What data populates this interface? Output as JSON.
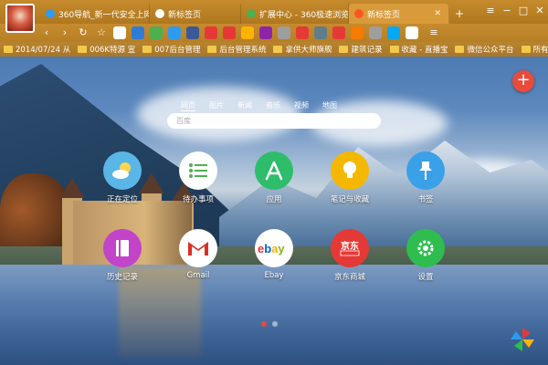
{
  "browser": {
    "tabs": [
      {
        "label": "360导航_新一代安全上网",
        "fav": "#2e9bf0",
        "active": false
      },
      {
        "label": "新标签页",
        "fav": "#ffffff",
        "active": false
      },
      {
        "label": "扩展中心 - 360极速浏览",
        "fav": "#4caf50",
        "active": false
      },
      {
        "label": "新标签页",
        "fav": "#ff5722",
        "active": true
      }
    ],
    "new_tab": "+",
    "win_controls": [
      "≡",
      "−",
      "□",
      "✕"
    ]
  },
  "navbar": {
    "back": "‹",
    "forward": "›",
    "refresh": "↻",
    "favorite": "☆",
    "extensions": [
      "#ffffff",
      "#2e7cd6",
      "#4caf50",
      "#2e9bf0",
      "#3b5998",
      "#e53935",
      "#e53935",
      "#ffb300",
      "#8e24aa",
      "#9e9e9e",
      "#e53935",
      "#607d8b",
      "#e53935",
      "#f57c00",
      "#9e9e9e",
      "#03a9f4",
      "#ffffff"
    ],
    "menu": "≡"
  },
  "bookmarks": [
    "2014/07/24 从",
    "006K特源 宣",
    "007后台管理",
    "后台管理系统",
    "拿供大师旗舰",
    "建筑记录",
    "收藏 - 直播宝",
    "微信公众平台",
    "所有主题&n"
  ],
  "search": {
    "tabs": [
      "网页",
      "图片",
      "新闻",
      "音乐",
      "视频",
      "地图"
    ],
    "active": 0,
    "placeholder": "百度"
  },
  "fab": "+",
  "apps": [
    {
      "label": "正在定位",
      "color": "#5bb6e8",
      "glyph": "☀"
    },
    {
      "label": "待办事项",
      "color": "#ffffff",
      "glyph": "☰"
    },
    {
      "label": "应用",
      "color": "#2ebd6b",
      "glyph": "A"
    },
    {
      "label": "笔记与收藏",
      "color": "#f5b800",
      "glyph": "💡"
    },
    {
      "label": "书签",
      "color": "#3aa0e8",
      "glyph": "📌"
    },
    {
      "label": "历史记录",
      "color": "#c244c8",
      "glyph": "▭"
    },
    {
      "label": "Gmail",
      "color": "#ffffff",
      "glyph": "M"
    },
    {
      "label": "Ebay",
      "color": "#ffffff",
      "glyph": "ebay"
    },
    {
      "label": "京东商城",
      "color": "#e53935",
      "glyph": "京东"
    },
    {
      "label": "设置",
      "color": "#2ebd4e",
      "glyph": "⚙"
    }
  ],
  "pager": {
    "pages": 2,
    "current": 0
  }
}
